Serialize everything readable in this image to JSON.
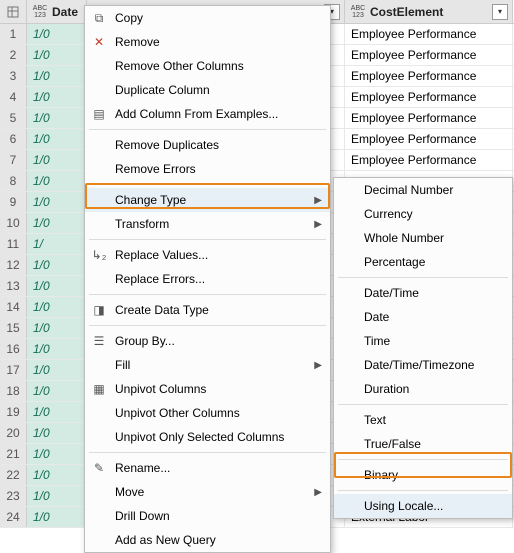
{
  "columns": {
    "date": "Date",
    "cost": "CostElement"
  },
  "rows": [
    {
      "n": 1,
      "d": "1/0",
      "c": "Employee Performance"
    },
    {
      "n": 2,
      "d": "1/0",
      "c": "Employee Performance"
    },
    {
      "n": 3,
      "d": "1/0",
      "c": "Employee Performance"
    },
    {
      "n": 4,
      "d": "1/0",
      "c": "Employee Performance"
    },
    {
      "n": 5,
      "d": "1/0",
      "c": "Employee Performance"
    },
    {
      "n": 6,
      "d": "1/0",
      "c": "Employee Performance"
    },
    {
      "n": 7,
      "d": "1/0",
      "c": "Employee Performance"
    },
    {
      "n": 8,
      "d": "1/0",
      "c": ""
    },
    {
      "n": 9,
      "d": "1/0",
      "c": ""
    },
    {
      "n": 10,
      "d": "1/0",
      "c": ""
    },
    {
      "n": 11,
      "d": "1/",
      "c": ""
    },
    {
      "n": 12,
      "d": "1/0",
      "c": ""
    },
    {
      "n": 13,
      "d": "1/0",
      "c": ""
    },
    {
      "n": 14,
      "d": "1/0",
      "c": ""
    },
    {
      "n": 15,
      "d": "1/0",
      "c": ""
    },
    {
      "n": 16,
      "d": "1/0",
      "c": ""
    },
    {
      "n": 17,
      "d": "1/0",
      "c": ""
    },
    {
      "n": 18,
      "d": "1/0",
      "c": ""
    },
    {
      "n": 19,
      "d": "1/0",
      "c": ""
    },
    {
      "n": 20,
      "d": "1/0",
      "c": ""
    },
    {
      "n": 21,
      "d": "1/0",
      "c": ""
    },
    {
      "n": 22,
      "d": "1/0",
      "c": ""
    },
    {
      "n": 23,
      "d": "1/0",
      "c": ""
    },
    {
      "n": 24,
      "d": "1/0",
      "c": "External Labor"
    }
  ],
  "menu1": {
    "copy": "Copy",
    "remove": "Remove",
    "removeOther": "Remove Other Columns",
    "duplicate": "Duplicate Column",
    "addFromEx": "Add Column From Examples...",
    "removeDup": "Remove Duplicates",
    "removeErr": "Remove Errors",
    "changeType": "Change Type",
    "transform": "Transform",
    "replaceVal": "Replace Values...",
    "replaceErr": "Replace Errors...",
    "createDT": "Create Data Type",
    "groupBy": "Group By...",
    "fill": "Fill",
    "unpivot": "Unpivot Columns",
    "unpivotOther": "Unpivot Other Columns",
    "unpivotSel": "Unpivot Only Selected Columns",
    "rename": "Rename...",
    "move": "Move",
    "drillDown": "Drill Down",
    "addNewQuery": "Add as New Query"
  },
  "menu2": {
    "decimal": "Decimal Number",
    "currency": "Currency",
    "whole": "Whole Number",
    "percentage": "Percentage",
    "datetime": "Date/Time",
    "date": "Date",
    "time": "Time",
    "dttz": "Date/Time/Timezone",
    "duration": "Duration",
    "text": "Text",
    "truefalse": "True/False",
    "binary": "Binary",
    "locale": "Using Locale..."
  }
}
